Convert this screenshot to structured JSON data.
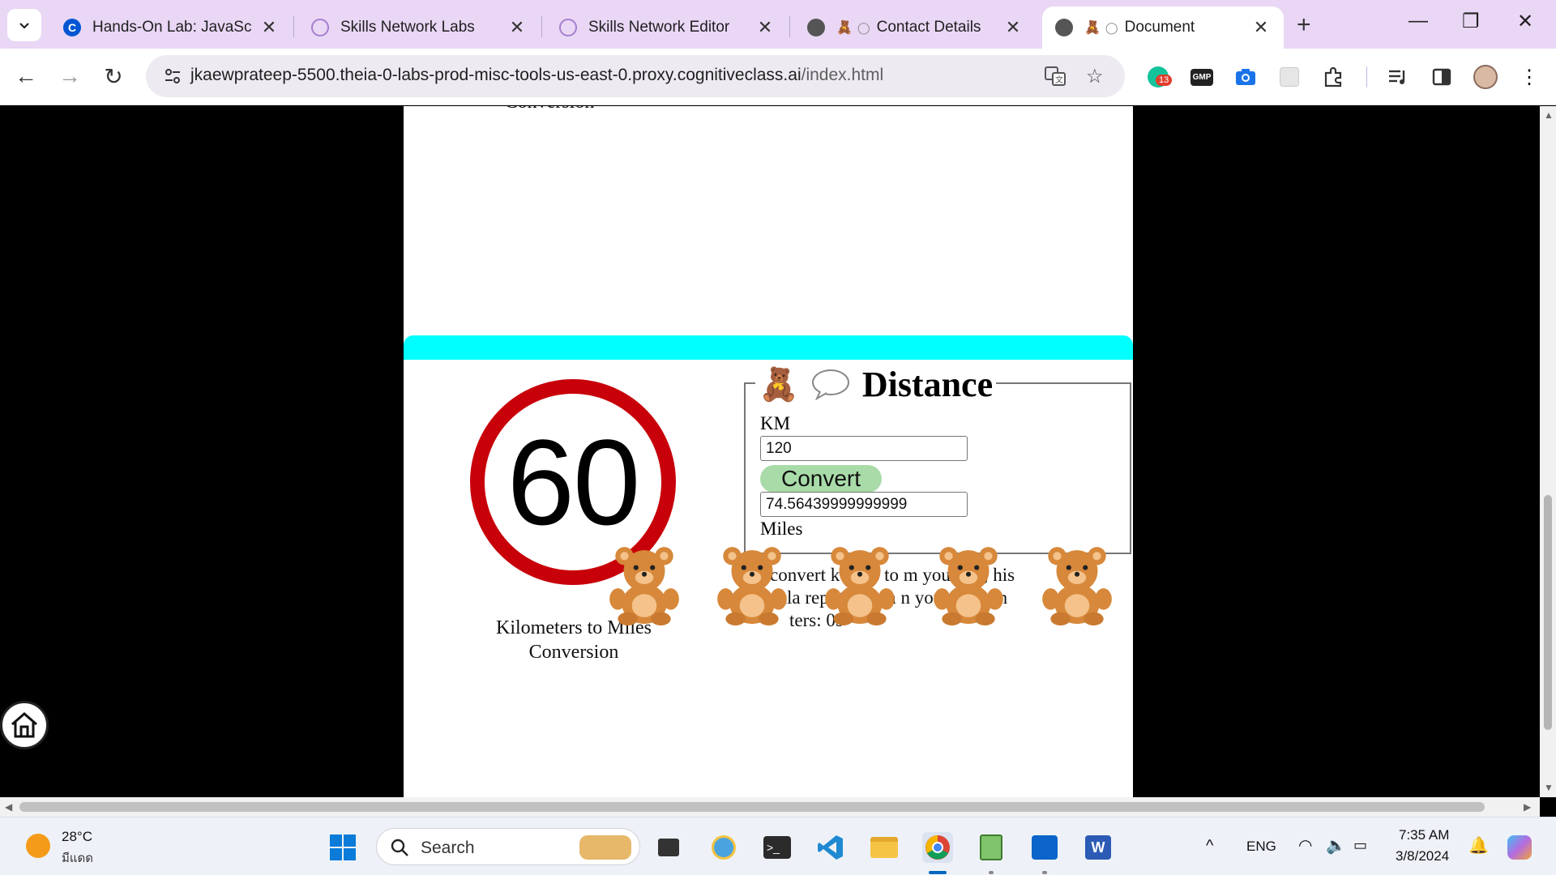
{
  "tabs": [
    {
      "title": "Hands-On Lab: JavaScript",
      "favicon": "coursera-c-icon"
    },
    {
      "title": "Skills Network Labs",
      "favicon": "skills-network-icon"
    },
    {
      "title": "Skills Network Editor",
      "favicon": "skills-network-icon"
    },
    {
      "title": "Contact Details",
      "favicon": "globe-icon"
    },
    {
      "title": "Document",
      "favicon": "globe-icon"
    }
  ],
  "address_bar": {
    "url_main": "jkaewprateep-5500.theia-0-labs-prod-misc-tools-us-east-0.proxy.cognitiveclass.ai",
    "url_path": "/index.html"
  },
  "extensions": {
    "badge_count": "13",
    "gmp_label": "GMP"
  },
  "top_card": {
    "caption_line2": "Conversion"
  },
  "main_card": {
    "speed_sign_value": "60",
    "caption_line1": "Kilometers to Miles",
    "caption_line2": "Conversion",
    "legend_title": "Distance",
    "km_label": "KM",
    "km_value": "120",
    "convert_label": "Convert",
    "miles_value": "74.56439999999999",
    "miles_label": "Miles",
    "description_line1": "convert k eters to m yourself, his",
    "description_line2": "nula repl the `km n your dis e in",
    "description_line3": "ters: 09"
  },
  "taskbar": {
    "temperature": "28°C",
    "weather": "มีแดด",
    "search_placeholder": "Search",
    "language": "ENG",
    "time": "7:35 AM",
    "date": "3/8/2024"
  },
  "colors": {
    "accent_bar": "#00ffff",
    "sign_ring": "#c8000a",
    "convert_button": "#a8dba8",
    "tab_strip": "#e9d7f5"
  }
}
